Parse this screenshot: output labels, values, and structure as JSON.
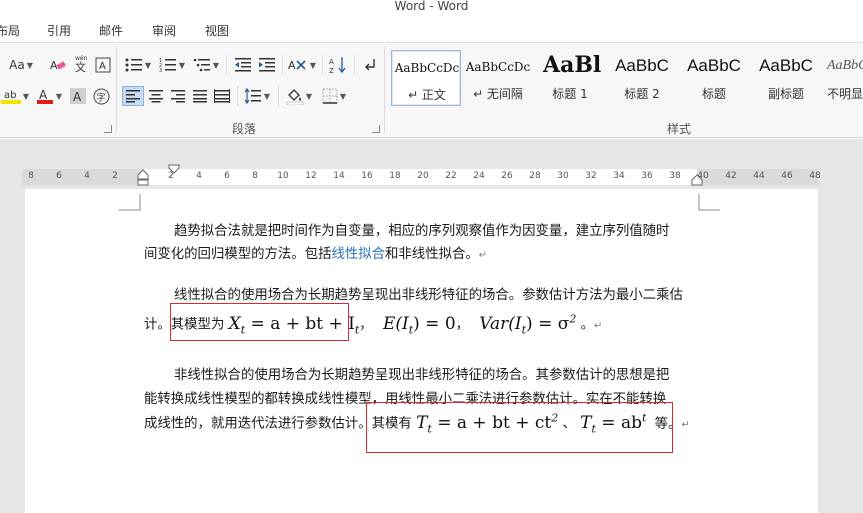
{
  "window": {
    "title": "Word - Word"
  },
  "tabs": [
    "布局",
    "引用",
    "邮件",
    "审阅",
    "视图"
  ],
  "ribbon": {
    "font_size_label": "Aa",
    "paragraph_group": "段落",
    "styles_group": "样式",
    "styles": [
      {
        "preview": "AaBbCcDc",
        "name": "↵ 正文"
      },
      {
        "preview": "AaBbCcDc",
        "name": "↵ 无间隔"
      },
      {
        "preview": "AaBl",
        "name": "标题 1"
      },
      {
        "preview": "AaBbC",
        "name": "标题 2"
      },
      {
        "preview": "AaBbC",
        "name": "标题"
      },
      {
        "preview": "AaBbC",
        "name": "副标题"
      },
      {
        "preview": "AaBbC",
        "name": "不明显"
      }
    ],
    "colors": {
      "highlight": "#f2e600",
      "font_color": "#e01b1b",
      "accent": "#2b579a"
    }
  },
  "ruler": {
    "numbers": [
      "8",
      "6",
      "4",
      "2",
      "2",
      "4",
      "6",
      "8",
      "10",
      "12",
      "14",
      "16",
      "18",
      "20",
      "22",
      "24",
      "26",
      "28",
      "30",
      "32",
      "34",
      "36",
      "38",
      "40",
      "42",
      "44",
      "46",
      "48"
    ]
  },
  "document": {
    "p1_line1": "趋势拟合法就是把时间作为自变量，相应的序列观察值作为因变量，建立序列值随时",
    "p1_line2_a": "间变化的回归模型的方法。包括",
    "p1_line2_link": "线性拟合",
    "p1_line2_b": "和非线性拟合。",
    "p2_line1": "线性拟合的使用场合为长期趋势呈现出非线形特征的场合。参数估计方法为最小二乘估",
    "p2_line2_a": "计。其模型为",
    "p2_formula1": "X",
    "p2_formula1_rest": " = a + bt + I",
    "p2_formula2": "E(I",
    "p2_formula2_rest": ") = 0",
    "p2_formula3": "Var(I",
    "p2_formula3_rest": ") = σ",
    "p3_line1": "非线性拟合的使用场合为长期趋势呈现出非线形特征的场合。其参数估计的思想是把",
    "p3_line2": "能转换成线性模型的都转换成线性模型，用线性最小二乘法进行参数估计。实在不能转换",
    "p3_line3_a": "成线性的，就用迭代法进行参数估计。其模有",
    "p3_formula1": "T",
    "p3_formula1_rest": " = a + bt + ct",
    "p3_sep": "、",
    "p3_formula2": "T",
    "p3_formula2_rest": " = ab",
    "p3_tail": "等。",
    "sub_t": "t",
    "sup_2": "2",
    "comma": "，",
    "period": "。",
    "para_mark": "↵"
  }
}
